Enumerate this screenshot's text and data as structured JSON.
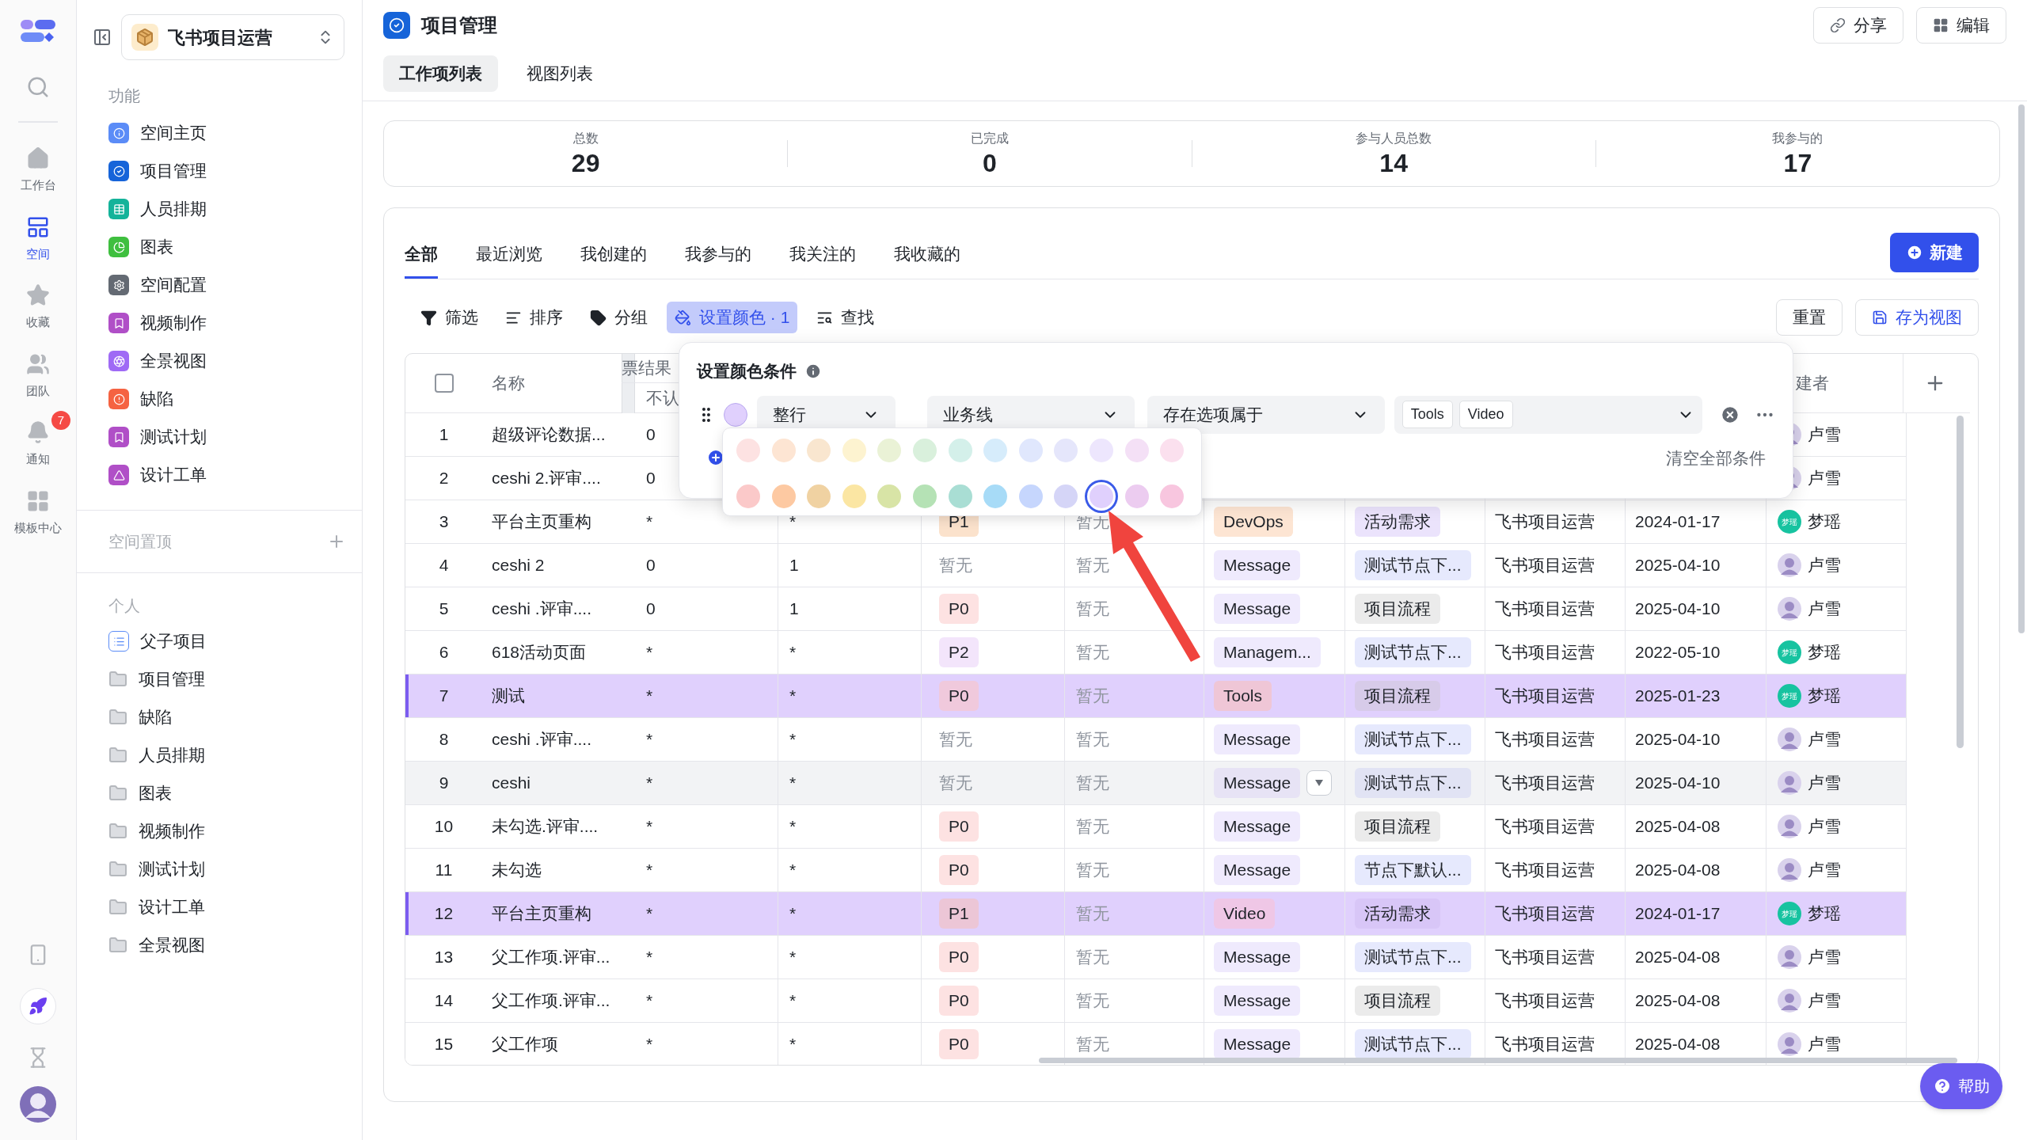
{
  "rail": {
    "items": [
      {
        "label": "工作台",
        "selected": false
      },
      {
        "label": "空间",
        "selected": true
      },
      {
        "label": "收藏",
        "selected": false
      },
      {
        "label": "团队",
        "selected": false
      },
      {
        "label": "通知",
        "selected": false,
        "badge": "7"
      },
      {
        "label": "模板中心",
        "selected": false
      }
    ]
  },
  "sidebar": {
    "space": "飞书项目运营",
    "features": {
      "title": "功能",
      "items": [
        {
          "label": "空间主页",
          "color": "#5b8cf7"
        },
        {
          "label": "项目管理",
          "color": "#1664d9"
        },
        {
          "label": "人员排期",
          "color": "#14b39a"
        },
        {
          "label": "图表",
          "color": "#3fbf3f"
        },
        {
          "label": "空间配置",
          "color": "#646a73"
        },
        {
          "label": "视频制作",
          "color": "#b04fc7"
        },
        {
          "label": "全景视图",
          "color": "#9f6af5"
        },
        {
          "label": "缺陷",
          "color": "#f56342"
        },
        {
          "label": "测试计划",
          "color": "#b04fc7"
        },
        {
          "label": "设计工单",
          "color": "#b04fc7"
        }
      ]
    },
    "pinned": {
      "title": "空间置顶"
    },
    "personal": {
      "title": "个人",
      "items": [
        {
          "label": "父子项目",
          "kind": "list"
        },
        {
          "label": "项目管理",
          "kind": "folder"
        },
        {
          "label": "缺陷",
          "kind": "folder"
        },
        {
          "label": "人员排期",
          "kind": "folder"
        },
        {
          "label": "图表",
          "kind": "folder"
        },
        {
          "label": "视频制作",
          "kind": "folder"
        },
        {
          "label": "测试计划",
          "kind": "folder"
        },
        {
          "label": "设计工单",
          "kind": "folder"
        },
        {
          "label": "全景视图",
          "kind": "folder"
        }
      ]
    }
  },
  "header": {
    "title": "项目管理",
    "tabs": [
      {
        "label": "工作项列表",
        "selected": true
      },
      {
        "label": "视图列表",
        "selected": false
      }
    ],
    "actions": [
      "分享",
      "编辑"
    ]
  },
  "stats": [
    {
      "label": "总数",
      "value": "29"
    },
    {
      "label": "已完成",
      "value": "0"
    },
    {
      "label": "参与人员总数",
      "value": "14"
    },
    {
      "label": "我参与的",
      "value": "17"
    }
  ],
  "filters": {
    "tabs": [
      {
        "label": "全部",
        "selected": true
      },
      {
        "label": "最近浏览",
        "selected": false
      },
      {
        "label": "我创建的",
        "selected": false
      },
      {
        "label": "我参与的",
        "selected": false
      },
      {
        "label": "我关注的",
        "selected": false
      },
      {
        "label": "我收藏的",
        "selected": false
      }
    ],
    "new_button": "新建"
  },
  "toolbar": {
    "tools": [
      {
        "label": "筛选",
        "selected": false
      },
      {
        "label": "排序",
        "selected": false
      },
      {
        "label": "分组",
        "selected": false
      },
      {
        "label": "设置颜色 · 1",
        "selected": true
      },
      {
        "label": "查找",
        "selected": false
      }
    ],
    "actions": [
      "重置",
      "存为视图"
    ]
  },
  "table": {
    "select_all": {
      "checked": false
    },
    "columns": {
      "name": "名称",
      "group": "票结果",
      "sub": "不认",
      "creator": "建者"
    },
    "rows": [
      {
        "no": "1",
        "name": "超级评论数据...",
        "c1": "0",
        "creator": {
          "name": "卢雪",
          "kind": "photo"
        },
        "highlighted": false,
        "hovered": false
      },
      {
        "no": "2",
        "name": "ceshi 2.评审....",
        "c1": "0",
        "creator": {
          "name": "卢雪",
          "kind": "photo"
        },
        "highlighted": false,
        "hovered": false
      },
      {
        "no": "3",
        "name": "平台主页重构",
        "c1": "*",
        "c2": "*",
        "priority": {
          "kind": "tag",
          "text": "P1",
          "color": "#fbe2cc"
        },
        "c4": "暂无",
        "line": {
          "text": "DevOps",
          "color": "#fde5d3"
        },
        "node": {
          "text": "活动需求",
          "color": "#ebe3fc"
        },
        "space": "飞书项目运营",
        "date": "2024-01-17",
        "creator": {
          "name": "梦瑶",
          "kind": "initials",
          "initials": "梦瑶"
        },
        "highlighted": false,
        "hovered": false
      },
      {
        "no": "4",
        "name": "ceshi 2",
        "c1": "0",
        "c2": "1",
        "priority": {
          "kind": "none",
          "text": "暂无"
        },
        "c4": "暂无",
        "line": {
          "text": "Message",
          "color": "#efeafd"
        },
        "node": {
          "text": "测试节点下...",
          "color": "#e6e9fd"
        },
        "space": "飞书项目运营",
        "date": "2025-04-10",
        "creator": {
          "name": "卢雪",
          "kind": "photo"
        },
        "highlighted": false,
        "hovered": false
      },
      {
        "no": "5",
        "name": "ceshi .评审....",
        "c1": "0",
        "c2": "1",
        "priority": {
          "kind": "tag",
          "text": "P0",
          "color": "#fde2e2"
        },
        "c4": "暂无",
        "line": {
          "text": "Message",
          "color": "#efeafd"
        },
        "node": {
          "text": "项目流程",
          "color": "#ebebeb"
        },
        "space": "飞书项目运营",
        "date": "2025-04-10",
        "creator": {
          "name": "卢雪",
          "kind": "photo"
        },
        "highlighted": false,
        "hovered": false
      },
      {
        "no": "6",
        "name": "618活动页面",
        "c1": "*",
        "c2": "*",
        "priority": {
          "kind": "tag",
          "text": "P2",
          "color": "#f3e5fb"
        },
        "c4": "暂无",
        "line": {
          "text": "Managem...",
          "color": "#efeafd"
        },
        "node": {
          "text": "测试节点下...",
          "color": "#e6e9fd"
        },
        "space": "飞书项目运营",
        "date": "2022-05-10",
        "creator": {
          "name": "梦瑶",
          "kind": "initials",
          "initials": "梦瑶"
        },
        "highlighted": false,
        "hovered": false
      },
      {
        "no": "7",
        "name": "测试",
        "c1": "*",
        "c2": "*",
        "priority": {
          "kind": "tag",
          "text": "P0",
          "color": "#f0c9dc"
        },
        "c4": "暂无",
        "line": {
          "text": "Tools",
          "color": "#efc6d6"
        },
        "node": {
          "text": "项目流程",
          "color": "#d7cbe9"
        },
        "space": "飞书项目运营",
        "date": "2025-01-23",
        "creator": {
          "name": "梦瑶",
          "kind": "initials",
          "initials": "梦瑶"
        },
        "highlighted": true,
        "hovered": false
      },
      {
        "no": "8",
        "name": "ceshi .评审....",
        "c1": "*",
        "c2": "*",
        "priority": {
          "kind": "none",
          "text": "暂无"
        },
        "c4": "暂无",
        "line": {
          "text": "Message",
          "color": "#efeafd"
        },
        "node": {
          "text": "测试节点下...",
          "color": "#e6e9fd"
        },
        "space": "飞书项目运营",
        "date": "2025-04-10",
        "creator": {
          "name": "卢雪",
          "kind": "photo"
        },
        "highlighted": false,
        "hovered": false
      },
      {
        "no": "9",
        "name": "ceshi",
        "c1": "*",
        "c2": "*",
        "priority": {
          "kind": "none",
          "text": "暂无"
        },
        "c4": "暂无",
        "line": {
          "text": "Message",
          "color": "#e7e3f5"
        },
        "node": {
          "text": "测试节点下...",
          "color": "#e1e3f4"
        },
        "space": "飞书项目运营",
        "date": "2025-04-10",
        "creator": {
          "name": "卢雪",
          "kind": "photo"
        },
        "highlighted": false,
        "hovered": true
      },
      {
        "no": "10",
        "name": "未勾选.评审....",
        "c1": "*",
        "c2": "*",
        "priority": {
          "kind": "tag",
          "text": "P0",
          "color": "#fde2e2"
        },
        "c4": "暂无",
        "line": {
          "text": "Message",
          "color": "#efeafd"
        },
        "node": {
          "text": "项目流程",
          "color": "#ebebeb"
        },
        "space": "飞书项目运营",
        "date": "2025-04-08",
        "creator": {
          "name": "卢雪",
          "kind": "photo"
        },
        "highlighted": false,
        "hovered": false
      },
      {
        "no": "11",
        "name": "未勾选",
        "c1": "*",
        "c2": "*",
        "priority": {
          "kind": "tag",
          "text": "P0",
          "color": "#fde2e2"
        },
        "c4": "暂无",
        "line": {
          "text": "Message",
          "color": "#efeafd"
        },
        "node": {
          "text": "节点下默认...",
          "color": "#e6e9fd"
        },
        "space": "飞书项目运营",
        "date": "2025-04-08",
        "creator": {
          "name": "卢雪",
          "kind": "photo"
        },
        "highlighted": false,
        "hovered": false
      },
      {
        "no": "12",
        "name": "平台主页重构",
        "c1": "*",
        "c2": "*",
        "priority": {
          "kind": "tag",
          "text": "P1",
          "color": "#ecc6d6"
        },
        "c4": "暂无",
        "line": {
          "text": "Video",
          "color": "#efc7e6"
        },
        "node": {
          "text": "活动需求",
          "color": "#d8c6f7"
        },
        "space": "飞书项目运营",
        "date": "2024-01-17",
        "creator": {
          "name": "梦瑶",
          "kind": "initials",
          "initials": "梦瑶"
        },
        "highlighted": true,
        "hovered": false
      },
      {
        "no": "13",
        "name": "父工作项.评审...",
        "c1": "*",
        "c2": "*",
        "priority": {
          "kind": "tag",
          "text": "P0",
          "color": "#fde2e2"
        },
        "c4": "暂无",
        "line": {
          "text": "Message",
          "color": "#efeafd"
        },
        "node": {
          "text": "测试节点下...",
          "color": "#e6e9fd"
        },
        "space": "飞书项目运营",
        "date": "2025-04-08",
        "creator": {
          "name": "卢雪",
          "kind": "photo"
        },
        "highlighted": false,
        "hovered": false
      },
      {
        "no": "14",
        "name": "父工作项.评审...",
        "c1": "*",
        "c2": "*",
        "priority": {
          "kind": "tag",
          "text": "P0",
          "color": "#fde2e2"
        },
        "c4": "暂无",
        "line": {
          "text": "Message",
          "color": "#efeafd"
        },
        "node": {
          "text": "项目流程",
          "color": "#ebebeb"
        },
        "space": "飞书项目运营",
        "date": "2025-04-08",
        "creator": {
          "name": "卢雪",
          "kind": "photo"
        },
        "highlighted": false,
        "hovered": false
      },
      {
        "no": "15",
        "name": "父工作项",
        "c1": "*",
        "c2": "*",
        "priority": {
          "kind": "tag",
          "text": "P0",
          "color": "#fde2e2"
        },
        "c4": "暂无",
        "line": {
          "text": "Message",
          "color": "#efeafd"
        },
        "node": {
          "text": "测试节点下...",
          "color": "#e6e9fd"
        },
        "space": "飞书项目运营",
        "date": "2025-04-08",
        "creator": {
          "name": "卢雪",
          "kind": "photo"
        },
        "highlighted": false,
        "hovered": false
      }
    ]
  },
  "color_rule": {
    "title": "设置颜色条件",
    "color": "#e0d0fd",
    "scope": "整行",
    "field": "业务线",
    "operator": "存在选项属于",
    "values": [
      "Tools",
      "Video"
    ],
    "clear_all": "清空全部条件"
  },
  "palette": {
    "swatches": [
      {
        "color": "#fde2e2",
        "selected": false
      },
      {
        "color": "#fde5d3",
        "selected": false
      },
      {
        "color": "#f9e6cf",
        "selected": false
      },
      {
        "color": "#fdf3d0",
        "selected": false
      },
      {
        "color": "#eaf2d6",
        "selected": false
      },
      {
        "color": "#d9f0dc",
        "selected": false
      },
      {
        "color": "#d4f0ea",
        "selected": false
      },
      {
        "color": "#d6ecfb",
        "selected": false
      },
      {
        "color": "#e0e7fd",
        "selected": false
      },
      {
        "color": "#e5e6fb",
        "selected": false
      },
      {
        "color": "#ede6fd",
        "selected": false
      },
      {
        "color": "#f4e0f6",
        "selected": false
      },
      {
        "color": "#fbe0ee",
        "selected": false
      },
      {
        "color": "#fbc9c9",
        "selected": false
      },
      {
        "color": "#fdc9a2",
        "selected": false
      },
      {
        "color": "#f0d2a2",
        "selected": false
      },
      {
        "color": "#fbe6a3",
        "selected": false
      },
      {
        "color": "#d8e4a6",
        "selected": false
      },
      {
        "color": "#b5e2b5",
        "selected": false
      },
      {
        "color": "#a9ded4",
        "selected": false
      },
      {
        "color": "#a7dbf7",
        "selected": false
      },
      {
        "color": "#c6d6fd",
        "selected": false
      },
      {
        "color": "#d5d5f7",
        "selected": false
      },
      {
        "color": "#e0d0fd",
        "selected": true
      },
      {
        "color": "#ecccf0",
        "selected": false
      },
      {
        "color": "#f8c6df",
        "selected": false
      }
    ]
  },
  "help_button": "帮助"
}
